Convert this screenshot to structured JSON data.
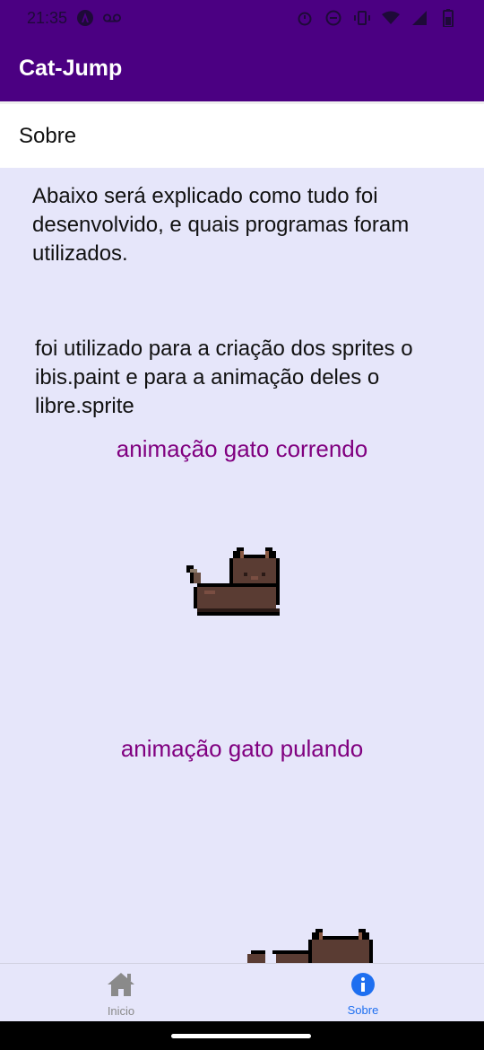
{
  "status_bar": {
    "time": "21:35",
    "left_icons": [
      "app-notification-icon",
      "voicemail-icon"
    ],
    "right_icons": [
      "alarm-icon",
      "dnd-icon",
      "vibrate-icon",
      "wifi-icon",
      "signal-icon",
      "battery-icon"
    ]
  },
  "app_bar": {
    "title": "Cat-Jump"
  },
  "sub_header": {
    "title": "Sobre"
  },
  "content": {
    "paragraph_1": "Abaixo será explicado como tudo foi desenvolvido, e quais programas foram utilizados.",
    "paragraph_2": " foi utilizado para a criação dos sprites o ibis.paint e para a animação deles o libre.sprite",
    "caption_running": "animação gato correndo",
    "caption_jumping": "animação gato pulando"
  },
  "tab_bar": {
    "tabs": [
      {
        "label": "Inicio",
        "icon": "home-icon",
        "active": false
      },
      {
        "label": "Sobre",
        "icon": "info-icon",
        "active": true
      }
    ]
  },
  "colors": {
    "primary": "#4b0082",
    "background": "#e6e6fa",
    "caption": "#800080",
    "active_tab": "#1e6ff0",
    "inactive_tab": "#8a8a8a"
  }
}
